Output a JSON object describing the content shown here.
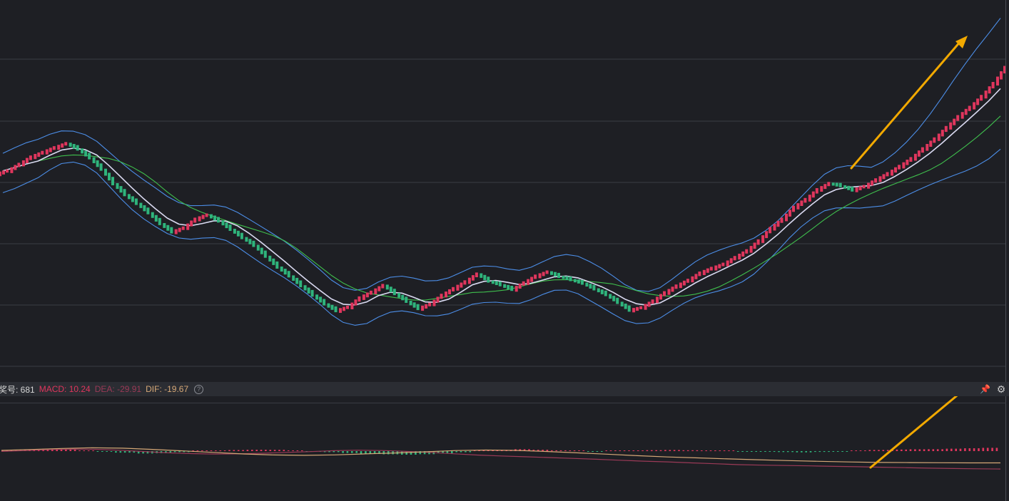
{
  "chart_data": [
    {
      "type": "candlestick",
      "title": "",
      "xlabel": "",
      "ylabel": "",
      "grid": true,
      "overlays": [
        "Bollinger upper",
        "Bollinger middle",
        "Bollinger lower",
        "moving average"
      ],
      "annotation": "trend arrow pointing upward near latest candles",
      "series": [
        {
          "values": [
            60.5,
            61.8,
            63.2,
            64.1,
            65.0,
            65.8,
            64.7,
            63.0,
            60.8,
            58.0,
            55.9,
            54.2,
            52.4,
            50.3,
            48.7,
            49.5,
            51.2,
            52.0,
            50.8,
            49.2,
            47.6,
            46.1,
            44.0,
            41.9,
            40.2,
            38.3,
            36.5,
            34.8,
            33.5,
            34.2,
            36.0,
            37.1,
            38.4,
            36.8,
            35.3,
            33.9,
            34.8,
            36.5,
            37.8,
            39.1,
            40.6,
            39.2,
            38.5,
            37.6,
            38.9,
            40.2,
            41.0,
            40.1,
            39.5,
            38.8,
            37.7,
            36.6,
            35.1,
            33.6,
            34.1,
            35.4,
            37.0,
            38.3,
            39.4,
            40.8,
            41.7,
            42.5,
            43.8,
            45.1,
            47.0,
            49.4,
            51.2,
            53.5,
            55.0,
            56.9,
            58.1,
            57.6,
            56.8,
            57.5,
            58.8,
            60.0,
            61.4,
            62.9,
            64.8,
            66.7,
            68.9,
            71.0,
            72.8,
            74.9,
            77.4,
            80.5
          ]
        },
        {
          "name": "",
          "values": []
        }
      ]
    },
    {
      "type": "macd",
      "series": [
        {
          "name": "MACD",
          "values": [
            3.2,
            5.5,
            7.1,
            4.8,
            1.9,
            -1.8,
            -4.7,
            -7.4,
            -6.5,
            -3.1,
            0.8,
            2.0,
            3.3,
            4.2,
            3.9,
            1.7,
            -0.9,
            -3.0,
            -5.8,
            -8.7,
            -10.1,
            -11.2,
            -9.5,
            -6.9,
            -3.3,
            0.5,
            3.8,
            6.1,
            4.2,
            2.5,
            0.8,
            -1.0,
            0.6,
            1.9,
            2.8,
            3.5,
            2.7,
            1.8,
            0.5,
            -0.8,
            -1.7,
            -2.9,
            -3.8,
            -2.5,
            -1.0,
            1.4,
            3.6,
            4.9,
            5.7,
            6.0,
            7.5,
            8.8,
            10.24
          ]
        },
        {
          "name": "DEA",
          "values": [
            -0.5,
            0.8,
            2.6,
            3.5,
            3.0,
            1.4,
            -0.7,
            -2.8,
            -4.2,
            -4.9,
            -4.5,
            -3.6,
            -2.2,
            -0.8,
            0.7,
            1.5,
            1.0,
            -0.5,
            -2.1,
            -4.4,
            -6.5,
            -8.1,
            -9.4,
            -10.7,
            -12.1,
            -13.6,
            -15.2,
            -16.8,
            -18.0,
            -19.7,
            -21.1,
            -22.6,
            -23.5,
            -24.1,
            -24.7,
            -25.5,
            -26.1,
            -26.9,
            -27.6,
            -28.4,
            -29.0,
            -29.5,
            -29.91
          ]
        },
        {
          "name": "DIF",
          "values": [
            1.2,
            2.7,
            4.4,
            5.6,
            4.9,
            2.8,
            0.4,
            -2.2,
            -4.8,
            -6.4,
            -7.0,
            -6.3,
            -4.6,
            -3.1,
            -1.2,
            0.9,
            1.8,
            1.2,
            -0.6,
            -2.8,
            -5.1,
            -7.6,
            -9.8,
            -11.3,
            -13.0,
            -14.4,
            -15.8,
            -17.0,
            -18.1,
            -18.9,
            -19.2,
            -19.4,
            -19.6,
            -19.67
          ]
        }
      ]
    }
  ],
  "indicator": {
    "label": "奖号: 681",
    "macd": "MACD: 10.24",
    "dea": "DEA: -29.91",
    "dif": "DIF: -19.67",
    "help": "?"
  },
  "icons": {
    "pin": "pin-icon",
    "gear": "gear-icon"
  },
  "colors": {
    "background": "#1e1f24",
    "up": "#e0365d",
    "down": "#2fb47c",
    "bollinger": "#4c8ee8",
    "middle": "#d9d9f0",
    "ma": "#3fbf4d",
    "arrow": "#f2a900",
    "dea": "#9b3a57",
    "dif": "#d6a877"
  }
}
